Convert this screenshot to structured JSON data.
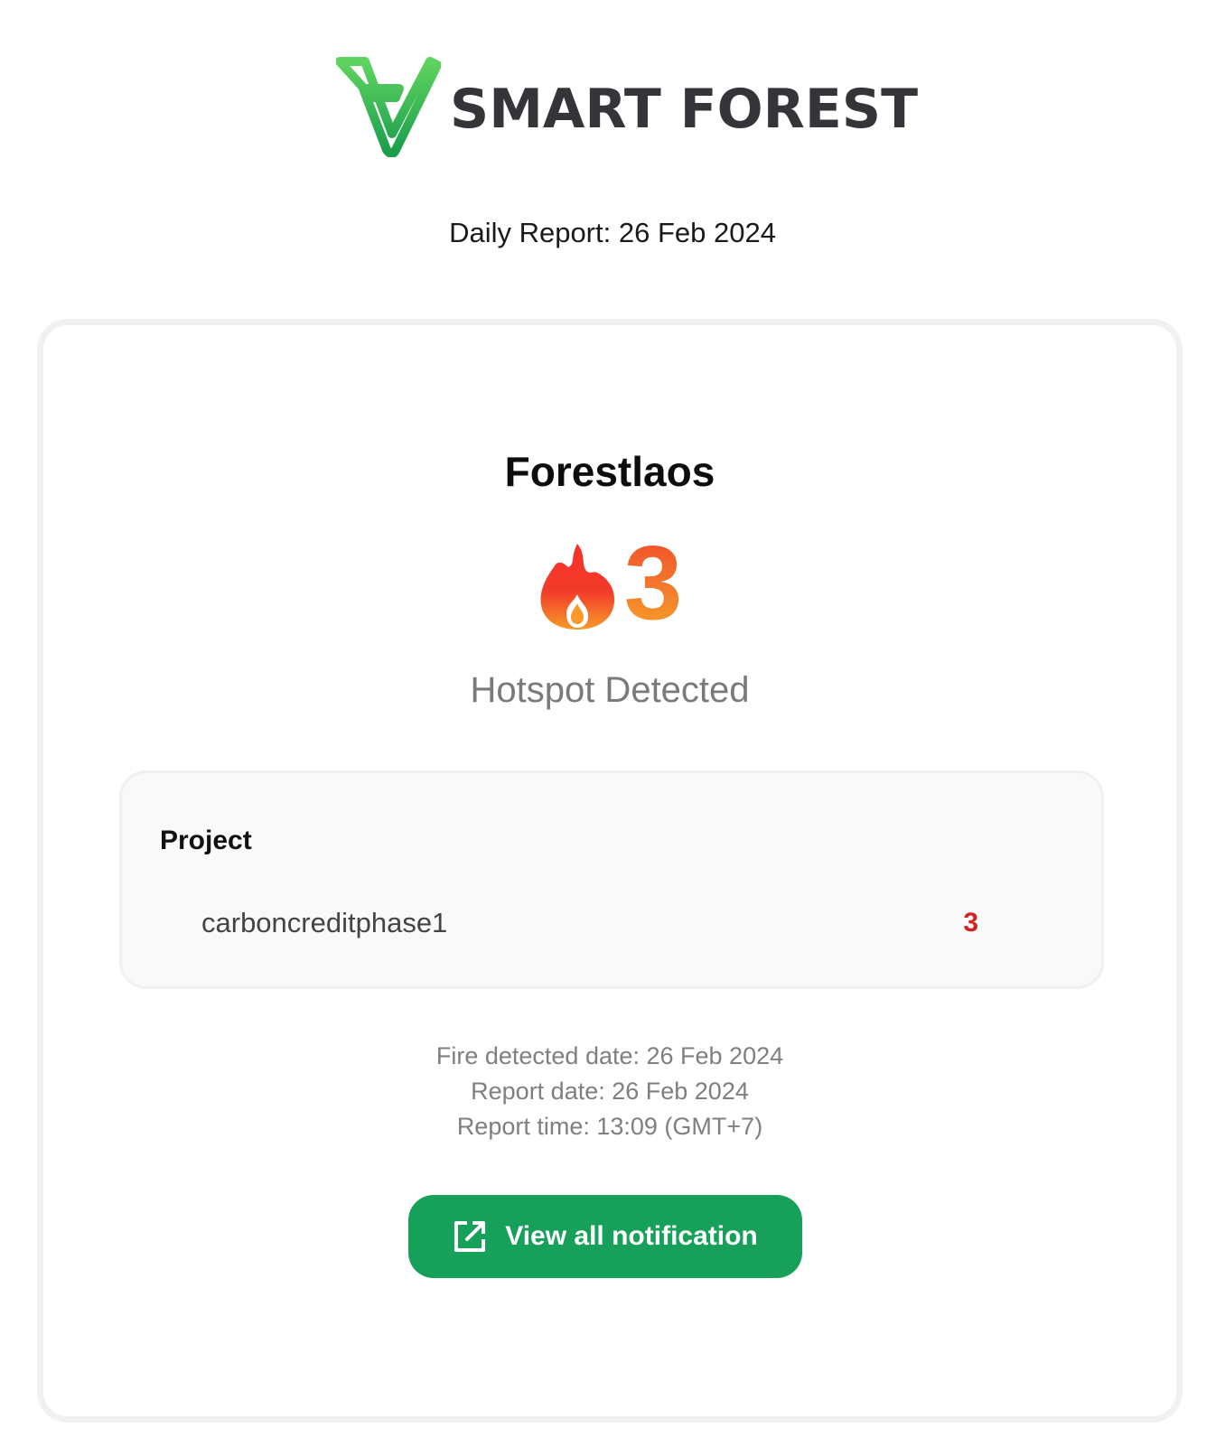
{
  "brand": {
    "name": "SMART FOREST",
    "logo_icon": "smart-forest-logo-icon",
    "accent_color": "#16a05a"
  },
  "report": {
    "title": "Daily Report: 26 Feb 2024"
  },
  "summary": {
    "organization": "Forestlaos",
    "fire_icon": "fire-icon",
    "hotspot_count": "3",
    "hotspot_label": "Hotspot Detected"
  },
  "projects": {
    "header": "Project",
    "items": [
      {
        "name": "carboncreditphase1",
        "count": "3"
      }
    ]
  },
  "meta": {
    "fire_detected_date": "Fire detected date: 26 Feb 2024",
    "report_date": "Report date: 26 Feb 2024",
    "report_time": "Report time: 13:09 (GMT+7)"
  },
  "actions": {
    "view_all_label": "View all notification",
    "view_all_icon": "external-link-icon"
  }
}
